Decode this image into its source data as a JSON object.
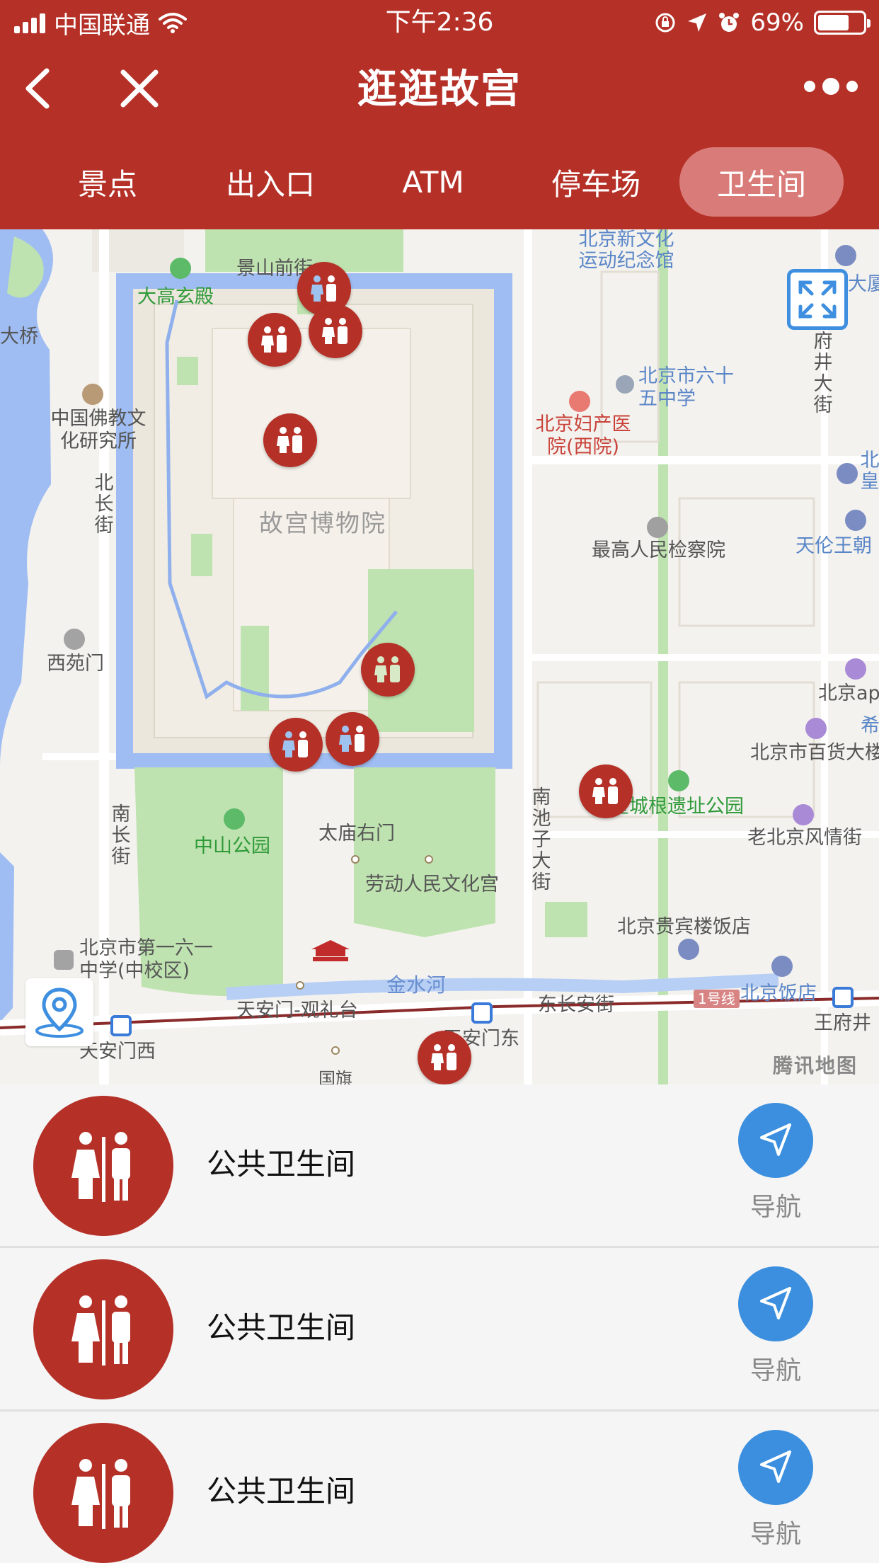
{
  "status_bar": {
    "carrier": "中国联通",
    "time": "下午2:36",
    "battery_percent": "69%",
    "battery_level": 0.69
  },
  "nav": {
    "title": "逛逛故宫"
  },
  "tabs": [
    {
      "label": "景点",
      "active": false
    },
    {
      "label": "出入口",
      "active": false
    },
    {
      "label": "ATM",
      "active": false
    },
    {
      "label": "停车场",
      "active": false
    },
    {
      "label": "卫生间",
      "active": true
    }
  ],
  "map": {
    "labels": {
      "museum": "故宫博物院",
      "jingshan": "景山前街",
      "dagao": "大高玄殿",
      "daqiao": "大桥",
      "buddhist": "中国佛教文化研究所",
      "beichang": "北长街",
      "xiyuanmen": "西苑门",
      "nanchang": "南长街",
      "zhongshan": "中山公园",
      "taimiao": "太庙右门",
      "laodong": "劳动人民文化宫",
      "no161": "北京市第一六一中学(中校区)",
      "tiananmen_stop": "天安门-观礼台",
      "jinshui": "金水河",
      "dongchangan": "东长安街",
      "line1": "1号线",
      "tiananmen_west": "天安门西",
      "tiananmen_east": "天安门东",
      "flag": "国旗",
      "nanchizi": "南池子大街",
      "xinwenhua": "北京新文化运动纪念馆",
      "no65": "北京市六十五中学",
      "fuchan": "北京妇产医院(西院)",
      "jianchayuan": "最高人民检察院",
      "wangfujing_st": "府井大街",
      "dasha": "大厦",
      "tianlun": "天伦王朝",
      "beihuang": "北皇",
      "apm": "北京apm",
      "xi": "希",
      "baihuo": "北京市百货大楼",
      "chengyuan": "皇城根遗址公园",
      "fengqing": "老北京风情街",
      "guibinlou": "北京贵宾楼饭店",
      "bjhotel": "北京饭店",
      "wangfujing": "王府井",
      "logo": "腾讯地图"
    },
    "markers_count": 9
  },
  "list": [
    {
      "title": "公共卫生间",
      "nav_label": "导航"
    },
    {
      "title": "公共卫生间",
      "nav_label": "导航"
    },
    {
      "title": "公共卫生间",
      "nav_label": "导航"
    }
  ],
  "colors": {
    "brand_red": "#b53128",
    "tab_active": "#d97c79",
    "nav_blue": "#3b8fde",
    "moat": "#9fbdf2",
    "park": "#bfe3b0"
  }
}
